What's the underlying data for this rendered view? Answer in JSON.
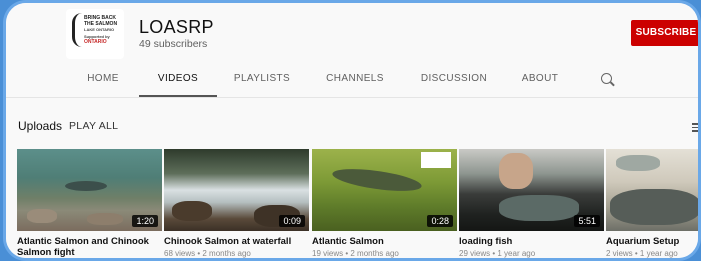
{
  "channel": {
    "name": "LOASRP",
    "subscribers": "49 subscribers",
    "logo_lines": [
      "BRING BACK",
      "THE SALMON",
      "LAKE ONTARIO",
      "Supported by",
      "ONTARIO"
    ]
  },
  "subscribe_label": "SUBSCRIBE",
  "tabs": [
    {
      "label": "HOME"
    },
    {
      "label": "VIDEOS"
    },
    {
      "label": "PLAYLISTS"
    },
    {
      "label": "CHANNELS"
    },
    {
      "label": "DISCUSSION"
    },
    {
      "label": "ABOUT"
    }
  ],
  "active_tab": "VIDEOS",
  "section": {
    "title": "Uploads",
    "play_all": "PLAY ALL"
  },
  "icons": {
    "search": "search-icon",
    "sort": "sort-icon"
  },
  "colors": {
    "subscribe_bg": "#cc0000",
    "background": "#f9f9f9"
  },
  "videos": [
    {
      "title": "Atlantic Salmon and Chinook Salmon fight",
      "duration": "1:20",
      "meta": ""
    },
    {
      "title": "Chinook Salmon at waterfall",
      "duration": "0:09",
      "meta": "68 views • 2 months ago"
    },
    {
      "title": "Atlantic Salmon",
      "duration": "0:28",
      "meta": "19 views • 2 months ago"
    },
    {
      "title": "loading fish",
      "duration": "5:51",
      "meta": "29 views • 1 year ago"
    },
    {
      "title": "Aquarium Setup",
      "duration": "",
      "meta": "2 views • 1 year ago"
    }
  ]
}
